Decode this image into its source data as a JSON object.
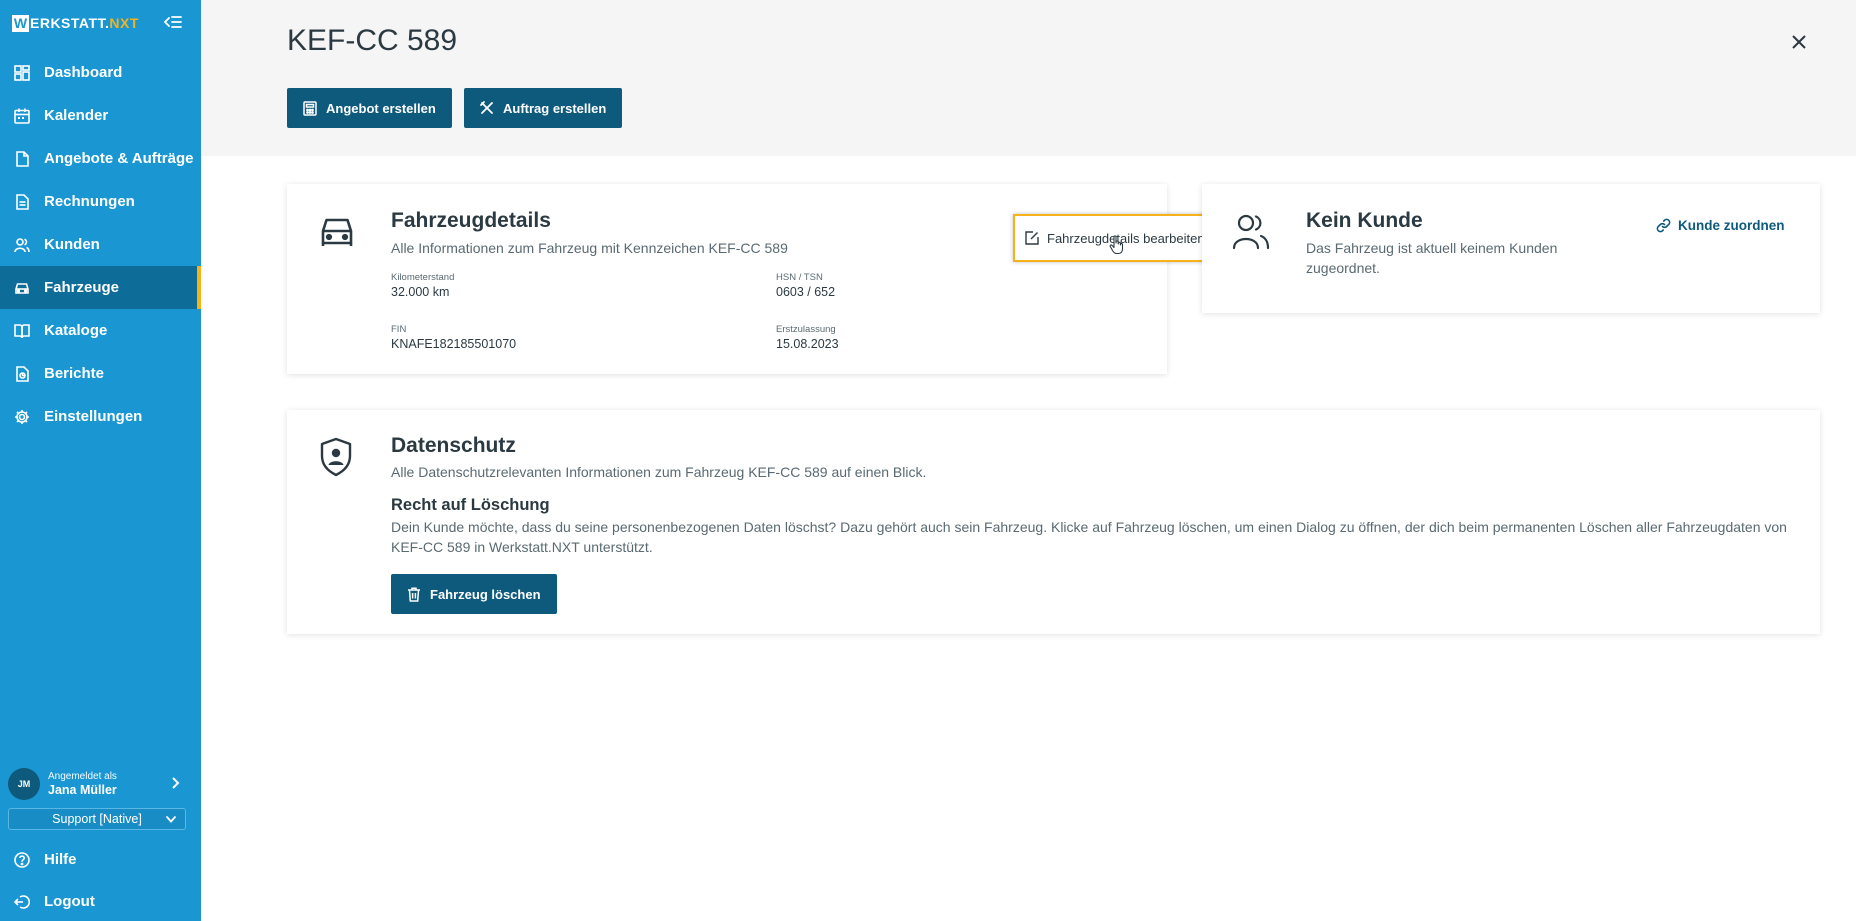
{
  "app": {
    "logo_letter": "W",
    "logo_text_main": "ERKSTATT.",
    "logo_text_accent": "NXT",
    "accent_color": "#f6b21a",
    "brand_color": "#1a97d3"
  },
  "sidebar": {
    "items": [
      {
        "label": "Dashboard",
        "icon": "dashboard-icon"
      },
      {
        "label": "Kalender",
        "icon": "calendar-icon"
      },
      {
        "label": "Angebote & Aufträge",
        "icon": "document-icon"
      },
      {
        "label": "Rechnungen",
        "icon": "invoice-icon"
      },
      {
        "label": "Kunden",
        "icon": "customers-icon"
      },
      {
        "label": "Fahrzeuge",
        "icon": "car-icon",
        "active": true
      },
      {
        "label": "Kataloge",
        "icon": "book-icon"
      },
      {
        "label": "Berichte",
        "icon": "report-icon"
      },
      {
        "label": "Einstellungen",
        "icon": "gear-icon"
      }
    ],
    "user": {
      "initials": "JM",
      "logged_in_as": "Angemeldet als",
      "name": "Jana Müller"
    },
    "role_select": {
      "value": "Support [Native]"
    },
    "help_label": "Hilfe",
    "logout_label": "Logout"
  },
  "header": {
    "title": "KEF-CC 589",
    "buttons": {
      "create_offer": "Angebot erstellen",
      "create_order": "Auftrag erstellen"
    }
  },
  "vehicle_card": {
    "title": "Fahrzeugdetails",
    "subtitle": "Alle Informationen zum Fahrzeug mit Kennzeichen KEF-CC 589",
    "edit_label": "Fahrzeugdetails bearbeiten",
    "fields": {
      "mileage_label": "Kilometerstand",
      "mileage_value": "32.000 km",
      "hsn_label": "HSN / TSN",
      "hsn_value": "0603 / 652",
      "fin_label": "FIN",
      "fin_value": "KNAFE182185501070",
      "registration_label": "Erstzulassung",
      "registration_value": "15.08.2023"
    }
  },
  "customer_card": {
    "title": "Kein Kunde",
    "subtitle": "Das Fahrzeug ist aktuell keinem Kunden zugeordnet.",
    "assign_label": "Kunde zuordnen"
  },
  "privacy_card": {
    "title": "Datenschutz",
    "subtitle": "Alle Datenschutzrelevanten Informationen zum Fahrzeug KEF-CC 589 auf einen Blick.",
    "section_title": "Recht auf Löschung",
    "section_text": "Dein Kunde möchte, dass du seine personenbezogenen Daten löschst? Dazu gehört auch sein Fahrzeug. Klicke auf Fahrzeug löschen, um einen Dialog zu öffnen, der dich beim permanenten Löschen aller Fahrzeugdaten von KEF-CC 589 in Werkstatt.NXT unterstützt.",
    "delete_label": "Fahrzeug löschen"
  }
}
